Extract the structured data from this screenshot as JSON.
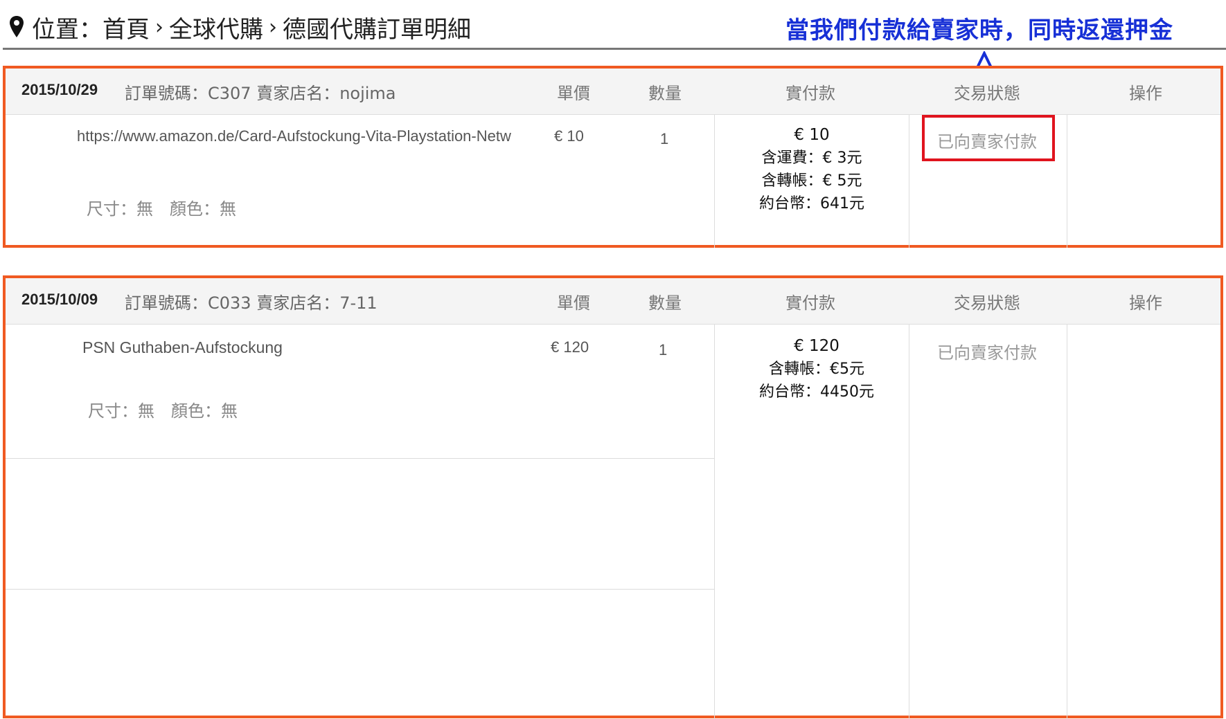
{
  "breadcrumb": {
    "prefix": "位置：",
    "items": [
      "首頁",
      "全球代購",
      "德國代購訂單明細"
    ],
    "separator": "›"
  },
  "annotation": {
    "text": "當我們付款給賣家時，同時返還押金",
    "color": "#1730d6"
  },
  "columns": {
    "unit_price": "單價",
    "quantity": "數量",
    "paid": "實付款",
    "status": "交易狀態",
    "actions": "操作"
  },
  "orders": [
    {
      "date": "2015/10/29",
      "meta": "訂單號碼：C307 賣家店名：nojima",
      "product": "https://www.amazon.de/Card-Aufstockung-Vita-Playstation-Netw",
      "spec": "尺寸：無　顏色：無",
      "unit_price": "€ 10",
      "quantity": "1",
      "paid_lines": [
        "€ 10",
        "含運費：€ 3元",
        "含轉帳：€ 5元",
        "約台幣：641元"
      ],
      "status": "已向賣家付款"
    },
    {
      "date": "2015/10/09",
      "meta": "訂單號碼：C033 賣家店名：7-11",
      "product": "PSN Guthaben-Aufstockung",
      "spec": "尺寸：無　顏色：無",
      "unit_price": "€ 120",
      "quantity": "1",
      "paid_lines": [
        "€ 120",
        "含轉帳：€5元",
        "約台幣：4450元"
      ],
      "status": "已向賣家付款"
    }
  ],
  "colors": {
    "order_border": "#f05a22",
    "status_highlight": "#e0141e",
    "header_bg": "#f4f4f4"
  }
}
